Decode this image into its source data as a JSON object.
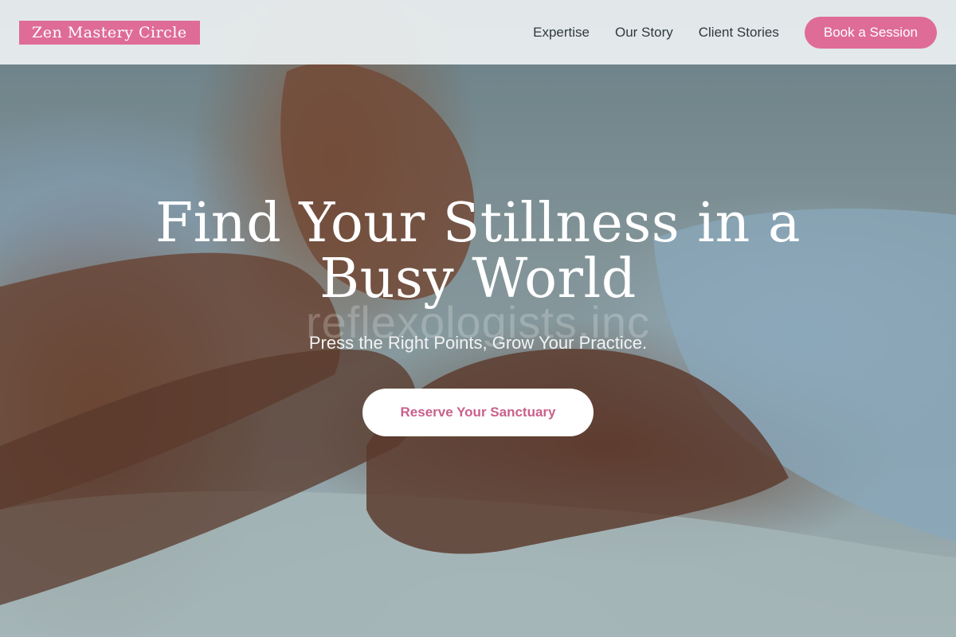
{
  "brand": {
    "logo_text": "Zen Mastery Circle"
  },
  "nav": {
    "links": [
      "Expertise",
      "Our Story",
      "Client Stories"
    ],
    "cta_label": "Book a Session"
  },
  "hero": {
    "title": "Find Your Stillness in a Busy World",
    "watermark": "reflexologists.inc",
    "subtitle": "Press the Right Points, Grow Your Practice.",
    "cta_label": "Reserve Your Sanctuary"
  },
  "colors": {
    "accent_pink": "#de6c96",
    "cta_text_pink": "#c9608a",
    "header_bg": "#eceff1",
    "nav_text": "#2e3a3f"
  },
  "images": {
    "hero_background": "reflexology-foot-massage-photo"
  }
}
